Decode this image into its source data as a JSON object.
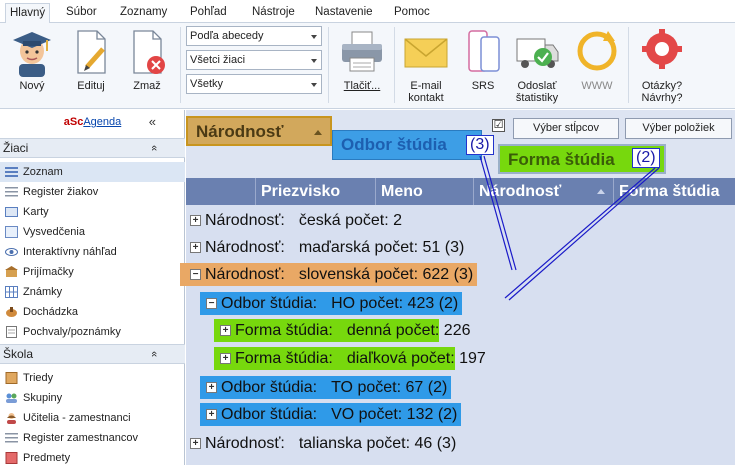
{
  "menu": {
    "tabs": [
      {
        "label": "Hlavný",
        "active": true
      },
      {
        "label": "Súbor"
      },
      {
        "label": "Zoznamy"
      },
      {
        "label": "Pohľad"
      },
      {
        "label": "Nástroje"
      },
      {
        "label": "Nastavenie"
      },
      {
        "label": "Pomoc"
      }
    ]
  },
  "ribbon": {
    "novy": "Nový",
    "edituj": "Edituj",
    "zmaz": "Zmaž",
    "combos": [
      "Podľa abecedy",
      "Všetci žiaci",
      "Všetky"
    ],
    "tlacit": "Tlačiť...",
    "email_line1": "E-mail",
    "email_line2": "kontakt",
    "srs": "SRS",
    "odoslat_line1": "Odoslať",
    "odoslat_line2": "štatistiky",
    "www": "WWW",
    "otazky_line1": "Otázky?",
    "otazky_line2": "Návrhy?"
  },
  "sidebar": {
    "brand_asc": "aSc",
    "brand_agenda": "Agenda",
    "collapse": "«",
    "section1": "Žiaci",
    "section1_items": [
      "Zoznam",
      "Register žiakov",
      "Karty",
      "Vysvedčenia",
      "Interaktívny náhľad",
      "Prijímačky",
      "Známky",
      "Dochádzka",
      "Pochvaly/poznámky"
    ],
    "section2": "Škola",
    "section2_items": [
      "Triedy",
      "Skupiny",
      "Učitelia - zamestnanci",
      "Register zamestnancov",
      "Predmety"
    ],
    "chev": "«"
  },
  "grid": {
    "group_chips": [
      "Národnosť",
      "Odbor štúdia",
      "Forma štúdia"
    ],
    "btn_columns": "Výber stĺpcov",
    "btn_items": "Výber položiek",
    "checkbox_mark": "☑",
    "badges": [
      "(3)",
      "(2)"
    ],
    "columns": [
      "Priezvisko",
      "Meno",
      "Národnosť",
      "Forma štúdia"
    ],
    "rows": [
      {
        "sign": "+",
        "label": "Národnosť:",
        "value": "česká",
        "count": "počet: 2",
        "badge": ""
      },
      {
        "sign": "+",
        "label": "Národnosť:",
        "value": "maďarská",
        "count": "počet: 51",
        "badge": "(3)"
      },
      {
        "sign": "−",
        "label": "Národnosť:",
        "value": "slovenská",
        "count": "počet: 622",
        "badge": "(3)"
      },
      {
        "sign": "−",
        "label": "Odbor štúdia:",
        "value": "HO",
        "count": "počet: 423",
        "badge": "(2)"
      },
      {
        "sign": "+",
        "label": "Forma štúdia:",
        "value": "denná",
        "count": "počet: 226",
        "badge": ""
      },
      {
        "sign": "+",
        "label": "Forma štúdia:",
        "value": "diaľková",
        "count": "počet: 197",
        "badge": ""
      },
      {
        "sign": "+",
        "label": "Odbor štúdia:",
        "value": "TO",
        "count": "počet: 67",
        "badge": "(2)"
      },
      {
        "sign": "+",
        "label": "Odbor štúdia:",
        "value": "VO",
        "count": "počet: 132",
        "badge": "(2)"
      },
      {
        "sign": "+",
        "label": "Národnosť:",
        "value": "talianska",
        "count": "počet: 46",
        "badge": "(3)"
      }
    ]
  },
  "colors": {
    "orange": "#e9a865",
    "blue": "#2f9ae8",
    "green": "#77d80d",
    "header": "#6a80b0"
  }
}
